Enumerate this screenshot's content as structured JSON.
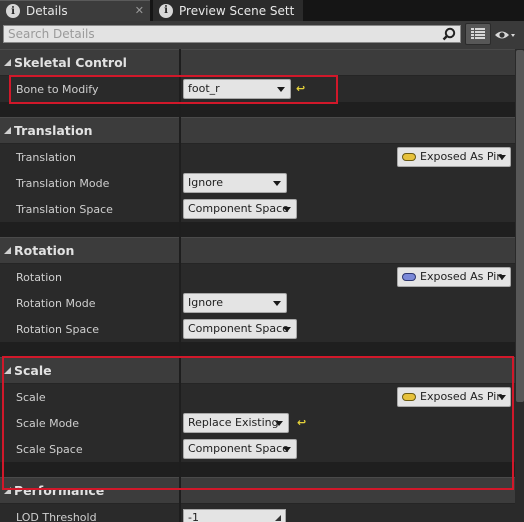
{
  "tabs": [
    {
      "label": "Details",
      "active": true
    },
    {
      "label": "Preview Scene Sett",
      "active": false
    }
  ],
  "search": {
    "placeholder": "Search Details"
  },
  "icons": {
    "tab_info": "info-icon",
    "close": "close-icon",
    "search": "search-icon",
    "grid_view": "grid-view-icon",
    "eye": "eye-icon",
    "reset": "reset-to-default-icon"
  },
  "colors": {
    "highlight_border": "#d1182a",
    "pin_yellow": "#e6c13a",
    "pin_blue": "#7a88d8",
    "reset_arrow": "#e5d23a"
  },
  "sections": {
    "skeletal_control": {
      "title": "Skeletal Control",
      "bone_to_modify": {
        "label": "Bone to Modify",
        "value": "foot_r"
      }
    },
    "translation": {
      "title": "Translation",
      "translation": {
        "label": "Translation",
        "pin": "Exposed As Pin"
      },
      "mode": {
        "label": "Translation Mode",
        "value": "Ignore"
      },
      "space": {
        "label": "Translation Space",
        "value": "Component Space"
      }
    },
    "rotation": {
      "title": "Rotation",
      "rotation": {
        "label": "Rotation",
        "pin": "Exposed As Pin"
      },
      "mode": {
        "label": "Rotation Mode",
        "value": "Ignore"
      },
      "space": {
        "label": "Rotation Space",
        "value": "Component Space"
      }
    },
    "scale": {
      "title": "Scale",
      "scale": {
        "label": "Scale",
        "pin": "Exposed As Pin"
      },
      "mode": {
        "label": "Scale Mode",
        "value": "Replace Existing"
      },
      "space": {
        "label": "Scale Space",
        "value": "Component Space"
      }
    },
    "performance": {
      "title": "Performance",
      "lod_threshold": {
        "label": "LOD Threshold",
        "value": "-1"
      }
    }
  }
}
